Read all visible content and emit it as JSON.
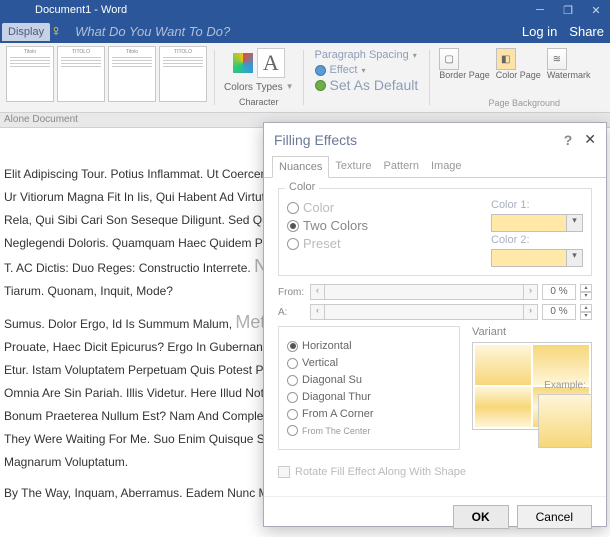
{
  "window": {
    "title": "Document1 - Word"
  },
  "header": {
    "tab": "Display",
    "tell_me": "What Do You Want To Do?",
    "login": "Log in",
    "share": "Share"
  },
  "ribbon": {
    "thumbs": [
      "Titolo",
      "TITOLO",
      "Titolo",
      "TITOLO"
    ],
    "colors": "Colors",
    "types": "Types",
    "char": "Character",
    "para_spacing": "Paragraph Spacing",
    "effect": "Effect",
    "set_default": "Set As Default",
    "border": "Border Page",
    "color": "Color Page",
    "watermark": "Watermark",
    "page_bg": "Page Background"
  },
  "alone": "Alone Document",
  "document": {
    "p1": "Elit Adipiscing Tour. Potius Inflammat. Ut Coercendi Magi",
    "p2": "Ur Vitiorum Magna Fit In Iis, Qui Habent Ad Virtutem Pro",
    "p3": "Rela, Qui Sibi Cari Son Seseque Diligunt. Sed Quae Tand",
    "p4": "Neglegendi Doloris. Quamquam Haec Quidem Praepositi",
    "p5": "T. AC Dictis: Duo Reges: Constructio Interrete.",
    "ghost1": "Nummusparency",
    "p6": "Tiarum. Quonam, Inquit, Mode?",
    "p7": "Sumus. Dolor Ergo, Id Is Summum Malum,",
    "ghost2": "Metuetutura",
    "p8": "Prouate, Haec Dicit Epicurus? Ergo In Gubernando Nihil,",
    "p9": "Etur. Istam Voluptatem Perpetuam Quis Potest Praest",
    "p10": "Omnia Are Sin Pariah. Illis Videtur. Here Illud Not Dub",
    "p11": "Bonum Praeterea Nullum Est? Nam And Complectitur V",
    "p12": "They Were Waiting For Me. Suo Enim Quisque Studio",
    "p13": "Magnarum Voluptatum.",
    "p14": "By The Way, Inquam, Aberramus. Eadem Nunc My Ad"
  },
  "dialog": {
    "title": "Filling Effects",
    "tabs": [
      "Nuances",
      "Texture",
      "Pattern",
      "Image"
    ],
    "color_section": "Color",
    "color_opts": [
      "Color",
      "Two Colors",
      "Preset"
    ],
    "color1_label": "Color 1:",
    "color2_label": "Color 2:",
    "from_label": "From:",
    "a_label": "A:",
    "pct": "0 %",
    "orientation": {
      "horizontal": "Horizontal",
      "vertical": "Vertical",
      "diag_up": "Diagonal Su",
      "diag_down": "Diagonal Thur",
      "corner": "From A Corner",
      "center": "From The Center"
    },
    "variant": "Variant",
    "example": "Example:",
    "rotate": "Rotate Fill Effect Along With Shape",
    "ok": "OK",
    "cancel": "Cancel"
  }
}
